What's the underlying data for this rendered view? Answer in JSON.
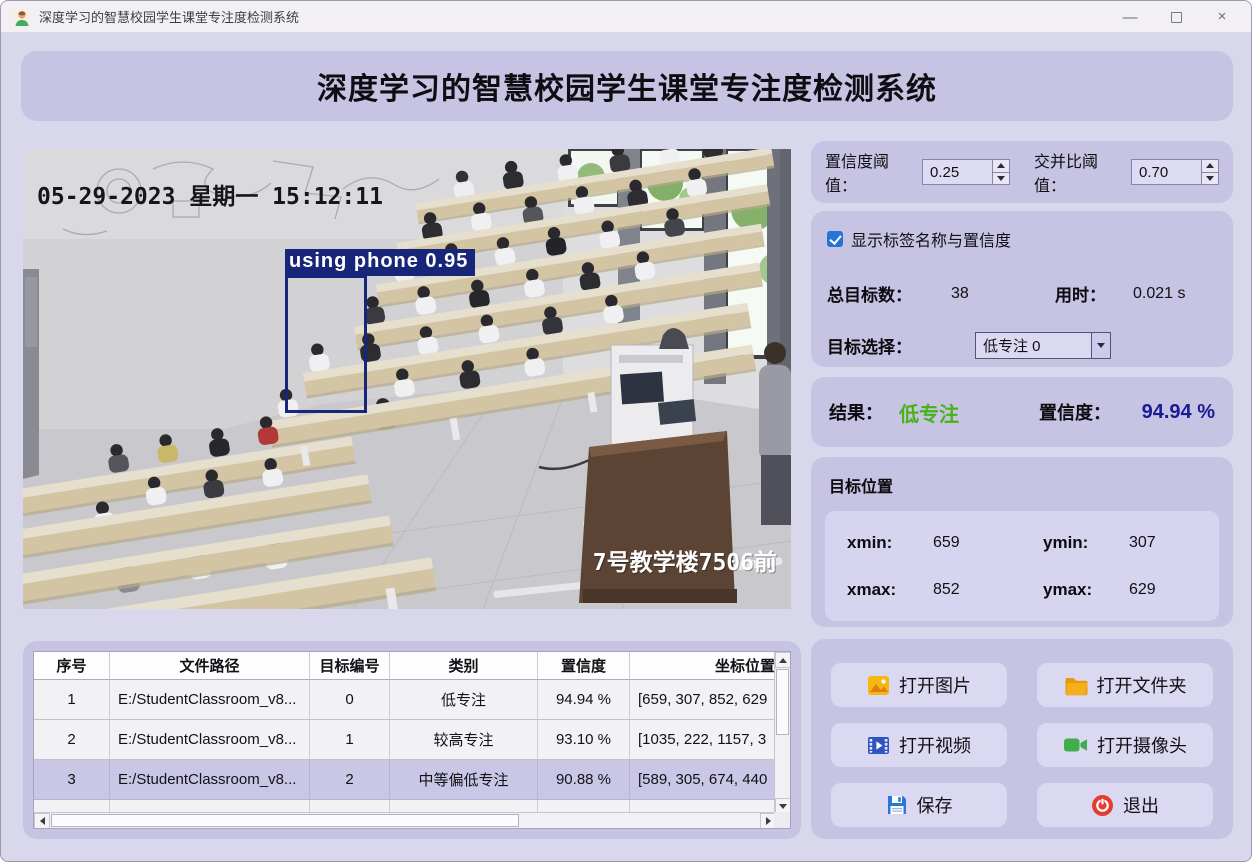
{
  "window": {
    "title": "深度学习的智慧校园学生课堂专注度检测系统",
    "minimize_glyph": "—",
    "close_glyph": "×"
  },
  "banner": {
    "title": "深度学习的智慧校园学生课堂专注度检测系统"
  },
  "viewer": {
    "timestamp": "05-29-2023 星期一 15:12:11",
    "location_watermark": "7号教学楼7506前",
    "detection_label": "using phone 0.95",
    "bbox_color": "#18267a"
  },
  "thresholds": {
    "conf_label": "置信度阈值：",
    "conf_value": "0.25",
    "iou_label": "交并比阈值：",
    "iou_value": "0.70"
  },
  "options": {
    "show_labels_checkbox": "显示标签名称与置信度",
    "checked": true,
    "total_label": "总目标数：",
    "total_value": "38",
    "time_label": "用时：",
    "time_value": "0.021 s",
    "target_select_label": "目标选择：",
    "target_selected": "低专注 0"
  },
  "result": {
    "label": "结果：",
    "value": "低专注",
    "value_color": "#47b318",
    "conf_label": "置信度：",
    "conf_value": "94.94 %",
    "conf_color": "#1a1a96"
  },
  "position": {
    "title": "目标位置",
    "xmin_label": "xmin:",
    "xmin": "659",
    "ymin_label": "ymin:",
    "ymin": "307",
    "xmax_label": "xmax:",
    "xmax": "852",
    "ymax_label": "ymax:",
    "ymax": "629"
  },
  "table": {
    "headers": [
      "序号",
      "文件路径",
      "目标编号",
      "类别",
      "置信度",
      "坐标位置"
    ],
    "rows": [
      [
        "1",
        "E:/StudentClassroom_v8...",
        "0",
        "低专注",
        "94.94 %",
        "[659, 307, 852, 629"
      ],
      [
        "2",
        "E:/StudentClassroom_v8...",
        "1",
        "较高专注",
        "93.10 %",
        "[1035, 222, 1157, 3"
      ],
      [
        "3",
        "E:/StudentClassroom_v8...",
        "2",
        "中等偏低专注",
        "90.88 %",
        "[589, 305, 674, 440"
      ]
    ],
    "selected_row_index": 2
  },
  "actions": {
    "open_image": "打开图片",
    "open_folder": "打开文件夹",
    "open_video": "打开视频",
    "open_camera": "打开摄像头",
    "save": "保存",
    "exit": "退出"
  },
  "colors": {
    "window_bg": "#d9d7eb",
    "panel_bg": "#c6c3e3",
    "control_bg": "#dbd9f2",
    "checkbox_blue": "#2575d8",
    "result_green": "#47b318",
    "confidence_navy": "#1a1a96"
  }
}
